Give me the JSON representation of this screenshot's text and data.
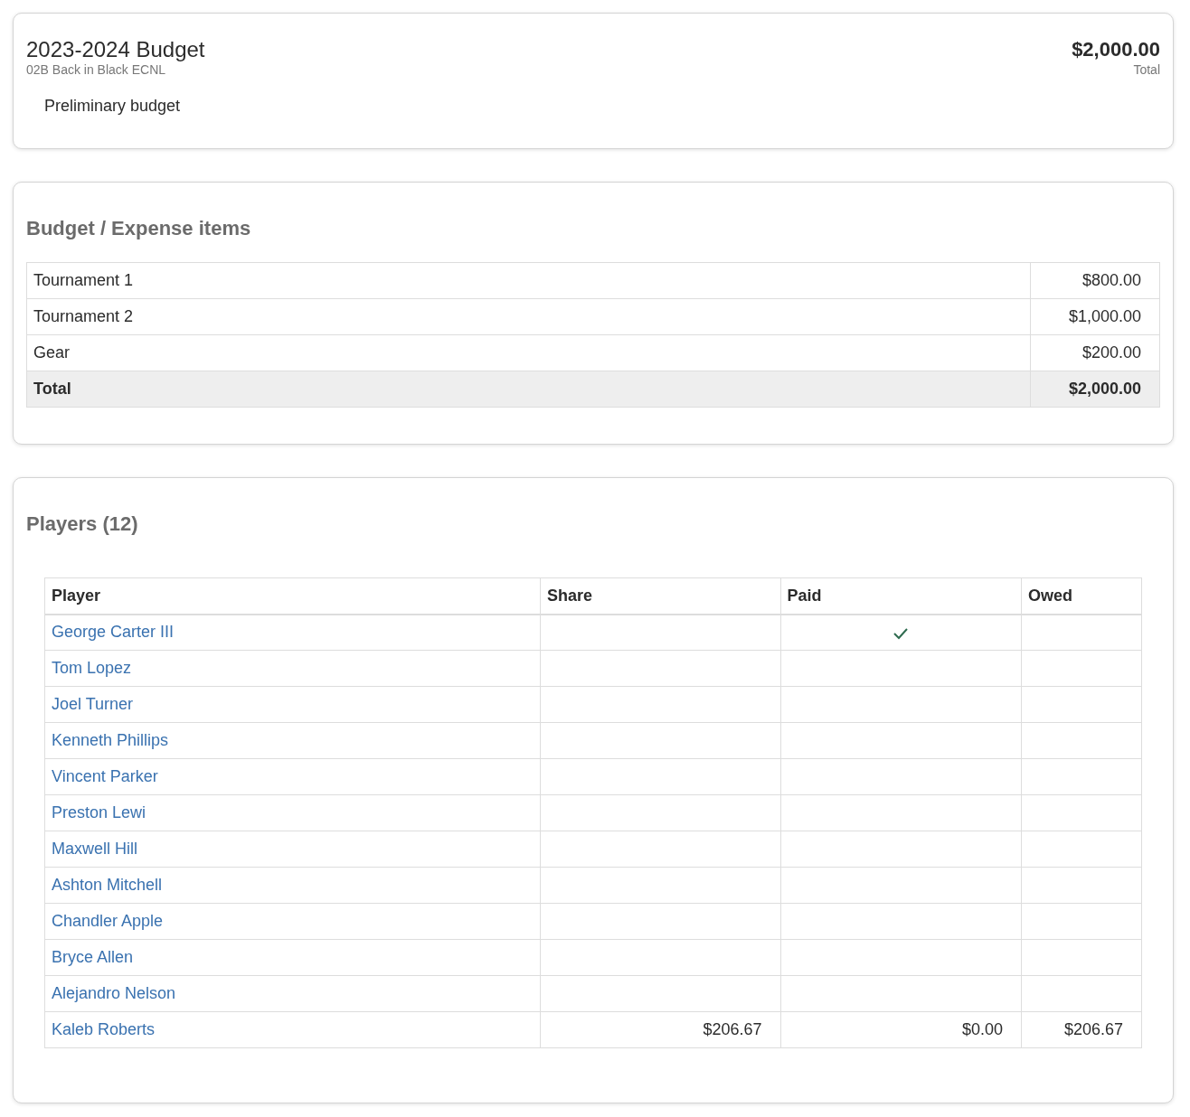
{
  "budget": {
    "title": "2023-2024 Budget",
    "team": "02B Back in Black ECNL",
    "amount": "$2,000.00",
    "amount_label": "Total",
    "note": "Preliminary budget"
  },
  "expenses": {
    "title": "Budget / Expense items",
    "rows": [
      {
        "name": "Tournament 1",
        "amount": "$800.00"
      },
      {
        "name": "Tournament 2",
        "amount": "$1,000.00"
      },
      {
        "name": "Gear",
        "amount": "$200.00"
      }
    ],
    "total": {
      "name": "Total",
      "amount": "$2,000.00"
    }
  },
  "players": {
    "title": "Players (12)",
    "columns": [
      "Player",
      "Share",
      "Paid",
      "Owed"
    ],
    "rows": [
      {
        "name": "George Carter III",
        "paid": true
      },
      {
        "name": "Tom Lopez",
        "paid": false
      },
      {
        "name": "Joel Turner",
        "paid": false
      },
      {
        "name": "Kenneth Phillips",
        "paid": false
      },
      {
        "name": "Vincent Parker",
        "paid": false
      },
      {
        "name": "Preston Lewi",
        "paid": false
      },
      {
        "name": "Maxwell Hill",
        "paid": false
      },
      {
        "name": "Ashton Mitchell",
        "paid": false
      },
      {
        "name": "Chandler Apple",
        "paid": false
      },
      {
        "name": "Bryce Allen",
        "paid": false
      },
      {
        "name": "Alejandro Nelson",
        "paid": false
      },
      {
        "name": "Kaleb Roberts",
        "paid": false,
        "share": "$206.67",
        "paid_amount": "$0.00",
        "owed": "$206.67"
      }
    ]
  }
}
